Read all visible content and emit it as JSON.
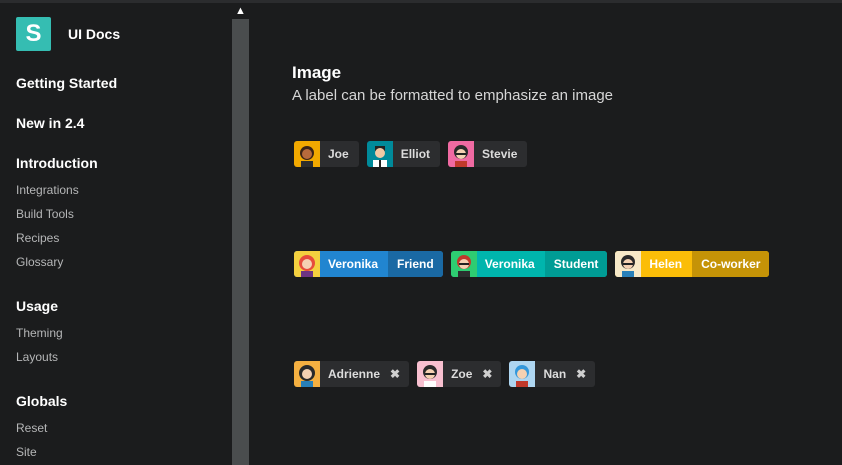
{
  "sidebar": {
    "app_title": "UI Docs",
    "logo_letter": "S",
    "sections": {
      "getting_started": "Getting Started",
      "new": "New in 2.4",
      "introduction": "Introduction",
      "usage": "Usage",
      "globals": "Globals"
    },
    "intro_items": [
      "Integrations",
      "Build Tools",
      "Recipes",
      "Glossary"
    ],
    "usage_items": [
      "Theming",
      "Layouts"
    ],
    "globals_items": [
      "Reset",
      "Site"
    ]
  },
  "scroll_up_glyph": "▲",
  "main": {
    "title": "Image",
    "subtitle": "A label can be formatted to emphasize an image",
    "row1": [
      {
        "name": "Joe",
        "avatar_icon": "avatar-joe-icon"
      },
      {
        "name": "Elliot",
        "avatar_icon": "avatar-elliot-icon"
      },
      {
        "name": "Stevie",
        "avatar_icon": "avatar-stevie-icon"
      }
    ],
    "row2": [
      {
        "name": "Veronika",
        "detail": "Friend",
        "color": "#2185d0"
      },
      {
        "name": "Veronika",
        "detail": "Student",
        "color": "#00b5ad"
      },
      {
        "name": "Helen",
        "detail": "Co-worker",
        "color": "#fbbd08"
      }
    ],
    "row3": [
      {
        "name": "Adrienne",
        "close": "✖"
      },
      {
        "name": "Zoe",
        "close": "✖"
      },
      {
        "name": "Nan",
        "close": "✖"
      }
    ]
  },
  "colors": {
    "accent": "#35bdb2",
    "background": "#1b1c1d",
    "label_bg": "#2c2d2f"
  }
}
